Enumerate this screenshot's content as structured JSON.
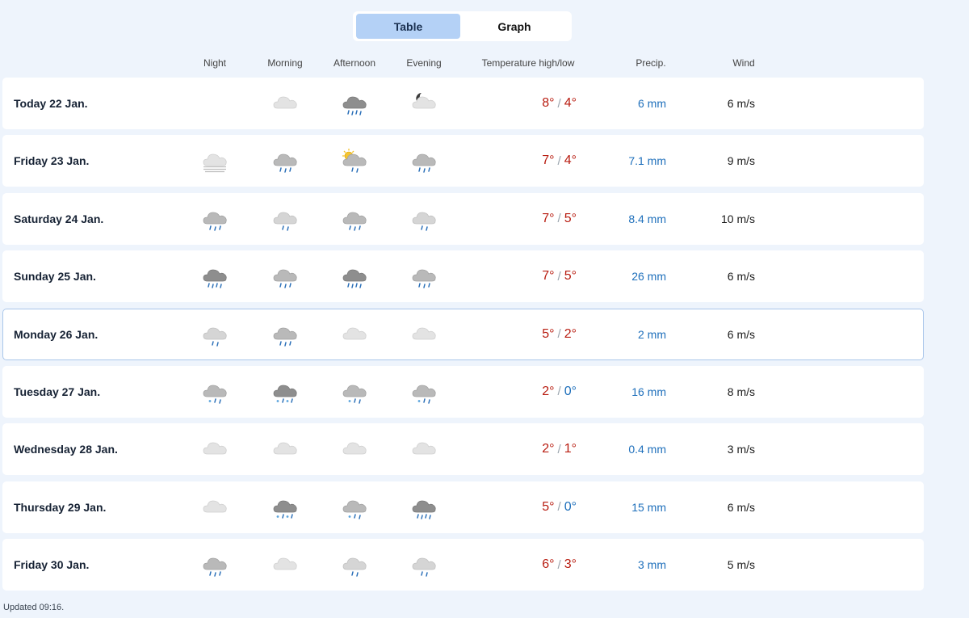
{
  "toggle": {
    "table_label": "Table",
    "graph_label": "Graph",
    "active": "table"
  },
  "headers": {
    "night": "Night",
    "morning": "Morning",
    "afternoon": "Afternoon",
    "evening": "Evening",
    "temperature": "Temperature high/low",
    "precip": "Precip.",
    "wind": "Wind"
  },
  "colors": {
    "accent": "#b4d1f6",
    "warm": "#b81c10",
    "cold": "#1e6fbb",
    "background": "#eef4fc"
  },
  "rows": [
    {
      "day": "Today 22 Jan.",
      "icons": [
        "",
        "cloud-icon",
        "heavy-rain-icon",
        "moon-cloud-icon"
      ],
      "high": "8°",
      "low": "4°",
      "low_type": "warm",
      "precip": "6 mm",
      "wind": "6 m/s"
    },
    {
      "day": "Friday 23 Jan.",
      "icons": [
        "fog-icon",
        "rain-cloud-icon",
        "sun-rain-icon",
        "rain-cloud-icon"
      ],
      "high": "7°",
      "low": "4°",
      "low_type": "warm",
      "precip": "7.1 mm",
      "wind": "9 m/s"
    },
    {
      "day": "Saturday 24 Jan.",
      "icons": [
        "rain-cloud-icon",
        "light-rain-icon",
        "rain-cloud-icon",
        "light-rain-icon"
      ],
      "high": "7°",
      "low": "5°",
      "low_type": "warm",
      "precip": "8.4 mm",
      "wind": "10 m/s"
    },
    {
      "day": "Sunday 25 Jan.",
      "icons": [
        "heavy-rain-icon",
        "rain-cloud-icon",
        "heavy-rain-icon",
        "rain-cloud-icon"
      ],
      "high": "7°",
      "low": "5°",
      "low_type": "warm",
      "precip": "26 mm",
      "wind": "6 m/s"
    },
    {
      "day": "Monday 26 Jan.",
      "icons": [
        "light-rain-icon",
        "rain-cloud-icon",
        "cloud-icon",
        "cloud-icon"
      ],
      "high": "5°",
      "low": "2°",
      "low_type": "warm",
      "precip": "2 mm",
      "wind": "6 m/s",
      "selected": true
    },
    {
      "day": "Tuesday 27 Jan.",
      "icons": [
        "sleet-icon",
        "heavy-sleet-icon",
        "sleet-icon",
        "sleet-icon"
      ],
      "high": "2°",
      "low": "0°",
      "low_type": "cold",
      "precip": "16 mm",
      "wind": "8 m/s"
    },
    {
      "day": "Wednesday 28 Jan.",
      "icons": [
        "cloud-icon",
        "cloud-icon",
        "cloud-icon",
        "cloud-icon"
      ],
      "high": "2°",
      "low": "1°",
      "low_type": "warm",
      "precip": "0.4 mm",
      "wind": "3 m/s"
    },
    {
      "day": "Thursday 29 Jan.",
      "icons": [
        "cloud-icon",
        "heavy-sleet-icon",
        "sleet-icon",
        "heavy-rain-icon"
      ],
      "high": "5°",
      "low": "0°",
      "low_type": "cold",
      "precip": "15 mm",
      "wind": "6 m/s"
    },
    {
      "day": "Friday 30 Jan.",
      "icons": [
        "rain-cloud-icon",
        "cloud-icon",
        "light-rain-icon",
        "light-rain-icon"
      ],
      "high": "6°",
      "low": "3°",
      "low_type": "warm",
      "precip": "3 mm",
      "wind": "5 m/s"
    }
  ],
  "footer": {
    "updated": "Updated 09:16."
  }
}
